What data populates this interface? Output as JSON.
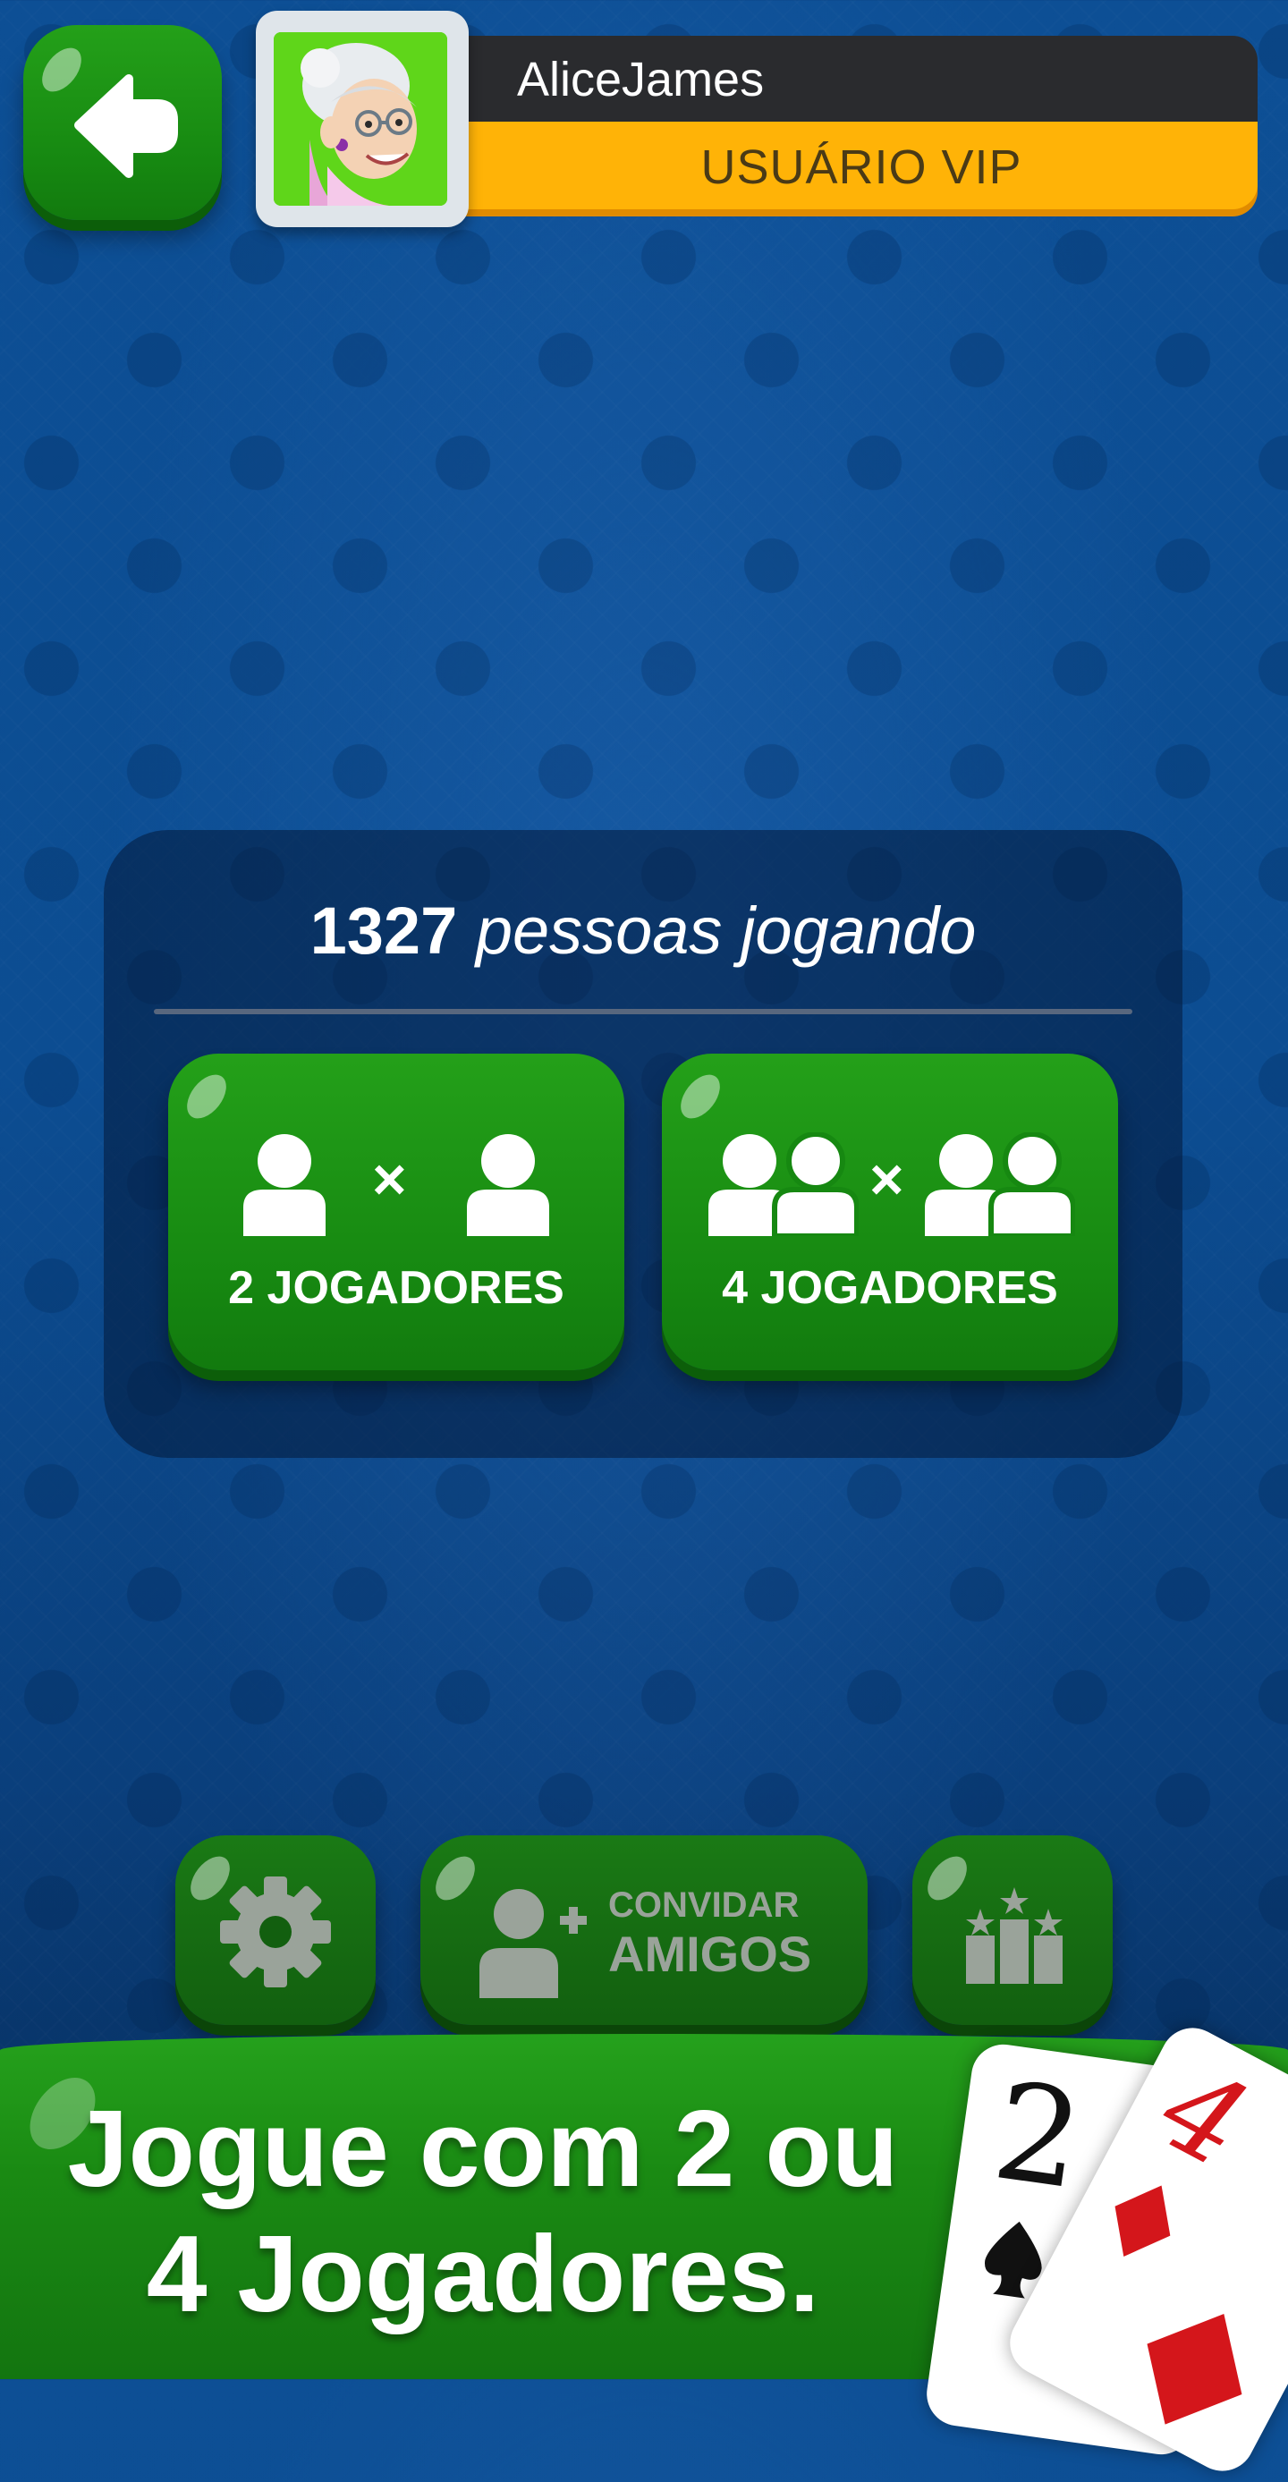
{
  "header": {
    "back_label": "back",
    "username": "AliceJames",
    "status": "USUÁRIO VIP"
  },
  "panel": {
    "online_count": "1327",
    "online_text": "pessoas jogando",
    "modes": [
      {
        "label": "2 JOGADORES"
      },
      {
        "label": "4 JOGADORES"
      }
    ],
    "versus_symbol": "×"
  },
  "toolbar": {
    "invite_line1": "CONVIDAR",
    "invite_line2": "AMIGOS"
  },
  "banner": {
    "line1": "Jogue com 2 ou",
    "line2": "4 Jogadores."
  },
  "cards": [
    {
      "rank": "2",
      "suit": "spade"
    },
    {
      "rank": "4",
      "suit": "diamond"
    }
  ],
  "colors": {
    "button_green": "#1a8f14",
    "vip_yellow": "#ffb307",
    "name_bar": "#2a2b2e",
    "avatar_bg": "#5fd61a"
  }
}
